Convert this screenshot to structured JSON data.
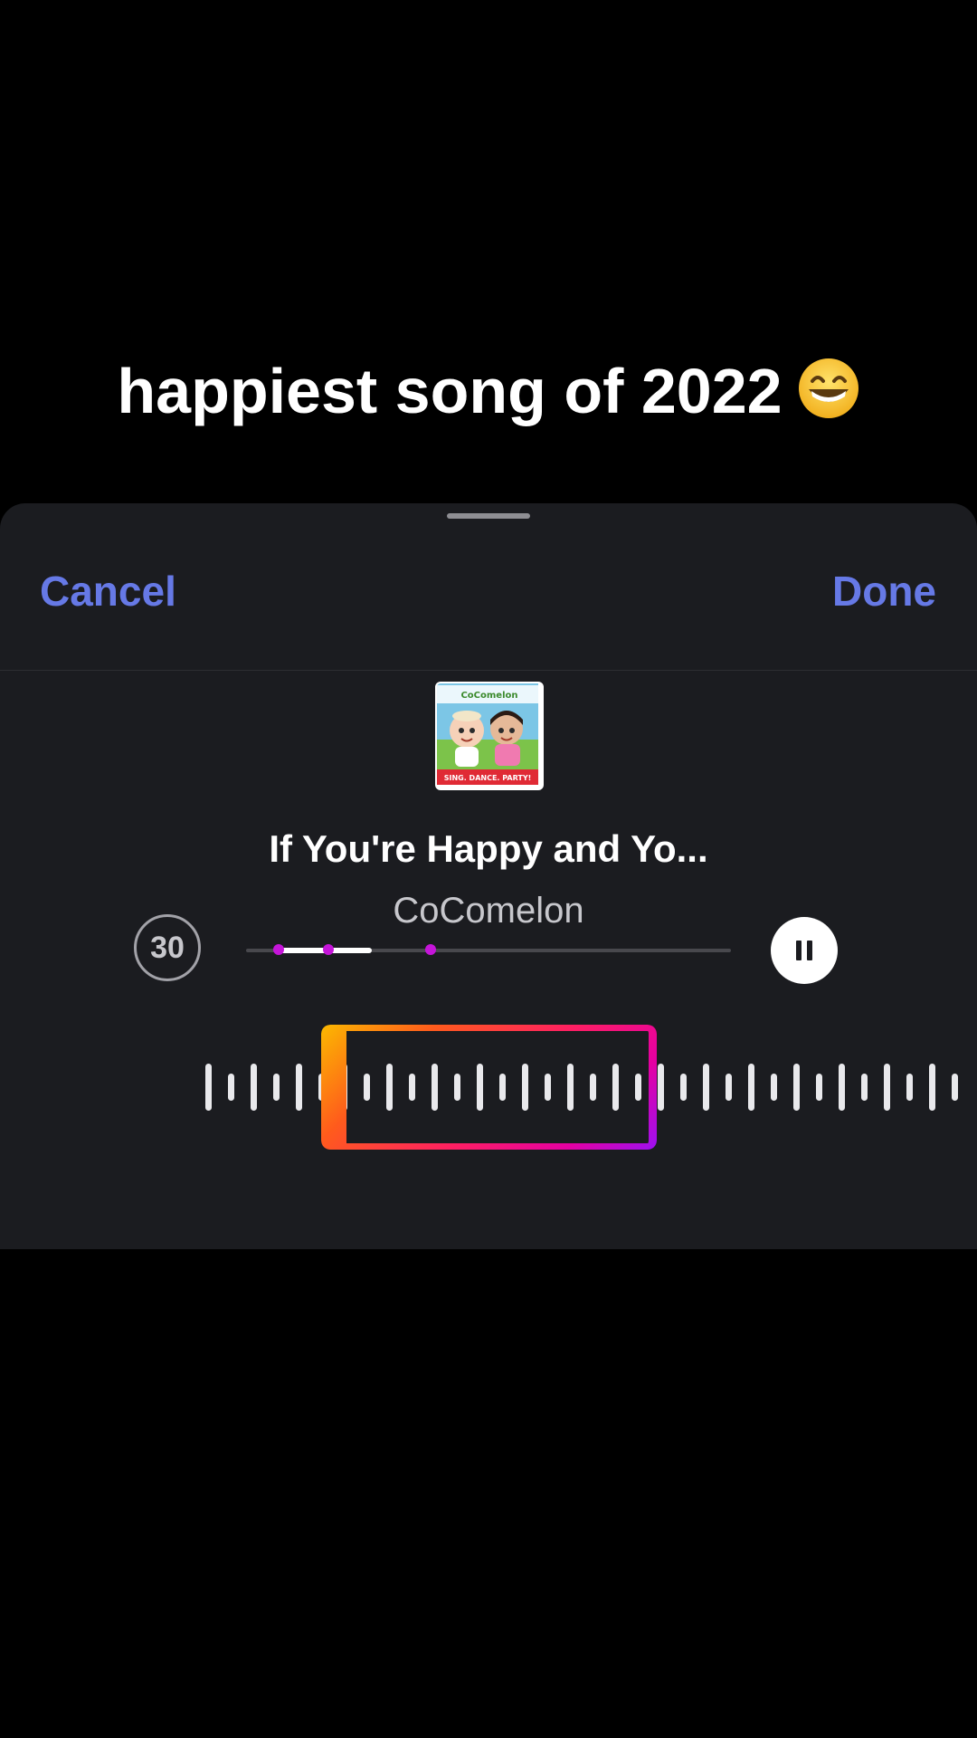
{
  "caption": {
    "text": "happiest song of 2022",
    "emoji": "grinning-face-emoji"
  },
  "header": {
    "cancel_label": "Cancel",
    "done_label": "Done"
  },
  "song": {
    "cover_text": "CoComelon",
    "cover_tagline": "SING. DANCE. PARTY!",
    "title": "If You're Happy and Yo...",
    "artist": "CoComelon"
  },
  "player": {
    "clip_duration": "30",
    "progress_start": 0.068,
    "progress_end": 0.26,
    "section_markers": [
      0.068,
      0.17,
      0.38
    ],
    "state": "playing",
    "button_icon": "pause-icon"
  },
  "waveform": {
    "selection_start": 0.165,
    "selection_end": 0.515
  },
  "colors": {
    "accent": "#6679e6",
    "sheet": "#1b1c20",
    "marker": "#c515d9",
    "selection_gradient": [
      "#fbb900",
      "#ff1f62",
      "#e500a1",
      "#9c10f2"
    ]
  }
}
